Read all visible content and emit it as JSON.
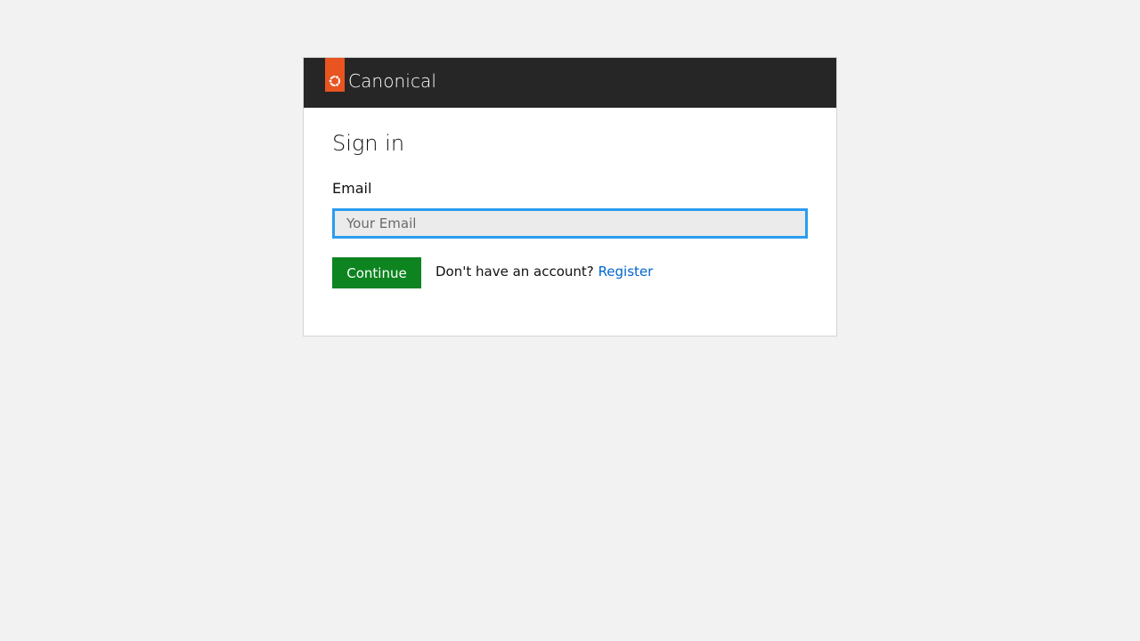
{
  "header": {
    "brand": "Canonical",
    "logo_icon": "ubuntu-circle-icon",
    "logo_color": "#e95420",
    "background": "#262626"
  },
  "form": {
    "title": "Sign in",
    "email_label": "Email",
    "email_value": "",
    "email_placeholder": "Your Email",
    "continue_label": "Continue",
    "continue_color": "#0e8420",
    "account_prompt": "Don't have an account?",
    "register_label": "Register",
    "link_color": "#0066cc",
    "focus_color": "#2c9cf0"
  }
}
